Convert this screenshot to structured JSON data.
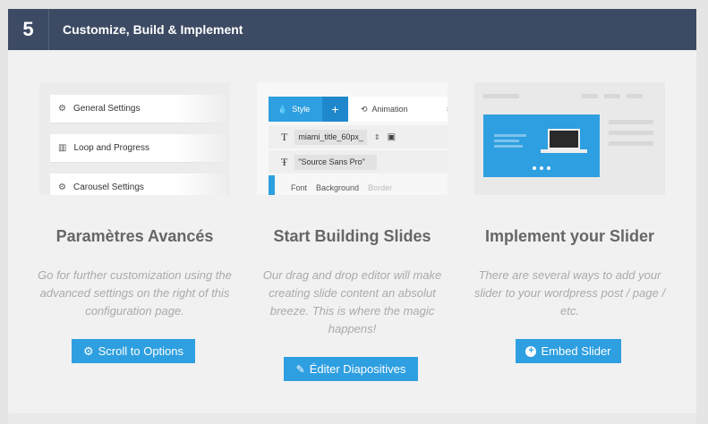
{
  "header": {
    "step": "5",
    "title": "Customize, Build & Implement"
  },
  "columns": [
    {
      "title": "Paramètres Avancés",
      "description": "Go for further customization using the advanced settings on the right of this configuration page.",
      "button": {
        "label": "Scroll to Options",
        "icon": "gear-icon"
      },
      "preview": {
        "rows": [
          "General Settings",
          "Loop and Progress",
          "Carousel Settings"
        ]
      }
    },
    {
      "title": "Start Building Slides",
      "description": "Our drag and drop editor will make creating slide content an absolut breeze. This is where the magic happens!",
      "button": {
        "label": "Éditer Diapositives",
        "icon": "pencil-icon"
      },
      "preview": {
        "tab_style": "Style",
        "tab_plus": "+",
        "tab_animation": "Animation",
        "field_class": "miami_title_60px_",
        "field_font": "\"Source Sans Pro\"",
        "tabs": [
          "Font",
          "Background",
          "Border"
        ]
      }
    },
    {
      "title": "Implement your Slider",
      "description": "There are several ways to add your slider to your wordpress post / page / etc.",
      "button": {
        "label": "Embed Slider",
        "icon": "plus-circle-icon"
      }
    }
  ],
  "colors": {
    "header_bg": "#3c4a63",
    "accent": "#2e9fe0",
    "panel_bg": "#f1f1f1"
  }
}
